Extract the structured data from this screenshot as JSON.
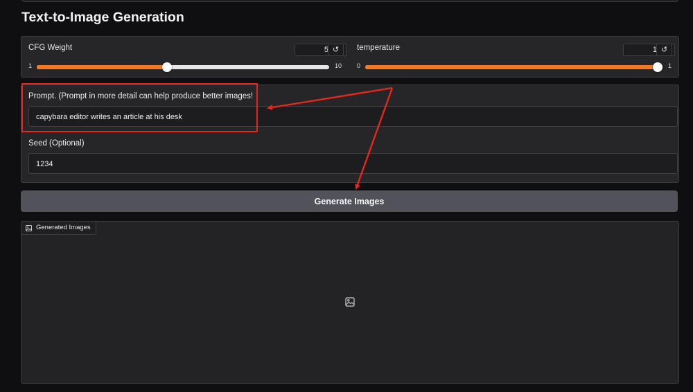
{
  "page": {
    "title": "Text-to-Image Generation"
  },
  "cfg_weight": {
    "label": "CFG Weight",
    "value": "5",
    "min_label": "1",
    "max_label": "10",
    "min": 1,
    "max": 10,
    "current": 5
  },
  "temperature": {
    "label": "temperature",
    "value": "1",
    "min_label": "0",
    "max_label": "1",
    "min": 0,
    "max": 1,
    "current": 1
  },
  "prompt": {
    "label": "Prompt. (Prompt in more detail can help produce better images!",
    "value": "capybara editor writes an article at his desk"
  },
  "seed": {
    "label": "Seed (Optional)",
    "value": "1234"
  },
  "generate_button": {
    "label": "Generate Images"
  },
  "output": {
    "tab_label": "Generated Images"
  },
  "colors": {
    "accent": "#f47922",
    "annotation": "#e5281b",
    "background": "#0f0f11",
    "panel": "#262629"
  },
  "icons": {
    "reset": "reset-icon",
    "image": "image-icon"
  }
}
